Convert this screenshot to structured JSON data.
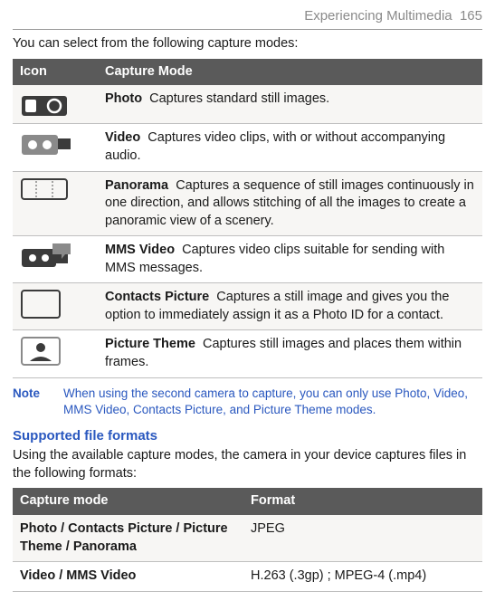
{
  "header": {
    "section": "Experiencing Multimedia",
    "page": "165"
  },
  "intro": "You can select from the following capture modes:",
  "modes_table": {
    "columns": {
      "icon": "Icon",
      "mode": "Capture Mode"
    },
    "rows": [
      {
        "name": "Photo",
        "desc": "Captures standard still images."
      },
      {
        "name": "Video",
        "desc": "Captures video clips, with or without accompanying audio."
      },
      {
        "name": "Panorama",
        "desc": "Captures a sequence of still images continuously in one direction, and allows stitching of all the images to create a panoramic view of a scenery."
      },
      {
        "name": "MMS Video",
        "desc": "Captures video clips suitable for sending with MMS messages."
      },
      {
        "name": "Contacts Picture",
        "desc": "Captures a still image and gives you the option to immediately assign it as a Photo ID for a contact."
      },
      {
        "name": "Picture Theme",
        "desc": "Captures still images and places them within frames."
      }
    ]
  },
  "note": {
    "label": "Note",
    "text": "When using the second camera to capture, you can only use Photo, Video, MMS Video, Contacts Picture, and Picture Theme modes."
  },
  "section2": {
    "title": "Supported file formats",
    "body": "Using the available capture modes, the camera in your device captures files in the following formats:"
  },
  "formats_table": {
    "columns": {
      "mode": "Capture mode",
      "format": "Format"
    },
    "rows": [
      {
        "mode": "Photo / Contacts Picture / Picture Theme / Panorama",
        "format": "JPEG"
      },
      {
        "mode": "Video / MMS Video",
        "format": "H.263 (.3gp) ; MPEG-4 (.mp4)"
      }
    ]
  }
}
